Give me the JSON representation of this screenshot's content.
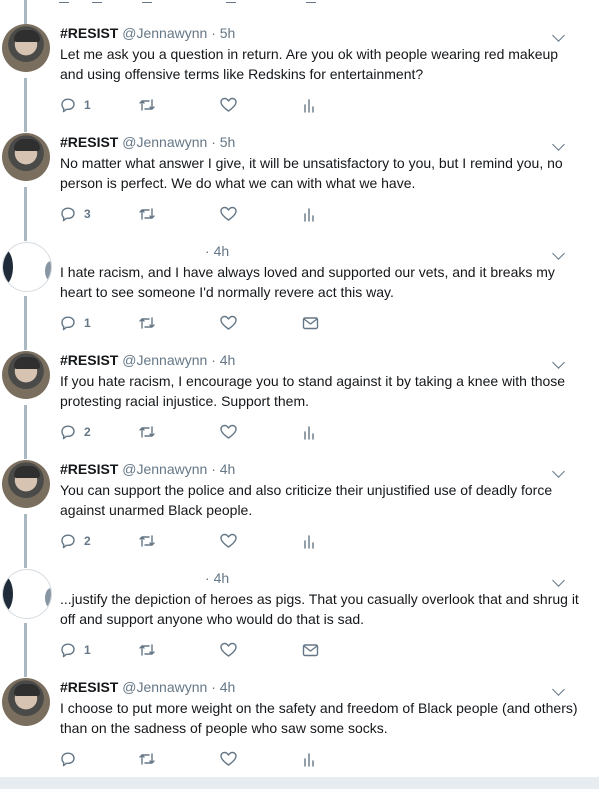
{
  "colors": {
    "thread_line": "#aab8c2",
    "text": "#14171a",
    "secondary": "#657786",
    "footer": "#e6ecf0"
  },
  "tweets": [
    {
      "name": "#RESIST",
      "handle": "@Jennawynn",
      "dot": "·",
      "time": "5h",
      "text": "Let me ask you a question in return. Are you ok with people wearing red makeup and using offensive terms like Redskins for entertainment?",
      "reply_count": "1",
      "extra_icon": "analytics-icon"
    },
    {
      "name": "#RESIST",
      "handle": "@Jennawynn",
      "dot": "·",
      "time": "5h",
      "text": "No matter what answer I give, it will be unsatisfactory to you, but I remind you, no person is perfect. We do what we can with what we have.",
      "reply_count": "3",
      "extra_icon": "analytics-icon"
    },
    {
      "name": "",
      "handle": "",
      "dot": "·",
      "time": "4h",
      "text": "I hate racism, and I have always loved and supported our vets, and it breaks my heart to see someone I'd normally revere act this way.",
      "reply_count": "1",
      "extra_icon": "direct-message-icon"
    },
    {
      "name": "#RESIST",
      "handle": "@Jennawynn",
      "dot": "·",
      "time": "4h",
      "text": "If you hate racism, I encourage you to stand against it by taking a knee with those protesting racial injustice. Support them.",
      "reply_count": "2",
      "extra_icon": "analytics-icon"
    },
    {
      "name": "#RESIST",
      "handle": "@Jennawynn",
      "dot": "·",
      "time": "4h",
      "text": "You can support the police and also criticize their unjustified use of deadly force against unarmed Black people.",
      "reply_count": "2",
      "extra_icon": "analytics-icon"
    },
    {
      "name": "",
      "handle": "",
      "dot": "·",
      "time": "4h",
      "text": "...justify the depiction of heroes as pigs.  That you casually overlook that and shrug it off and support anyone who would do that is sad.",
      "reply_count": "1",
      "extra_icon": "direct-message-icon"
    },
    {
      "name": "#RESIST",
      "handle": "@Jennawynn",
      "dot": "·",
      "time": "4h",
      "text": "I choose to put more weight on the safety and freedom of Black people (and others) than on the sadness of people who saw some socks.",
      "reply_count": "",
      "extra_icon": "analytics-icon"
    }
  ]
}
